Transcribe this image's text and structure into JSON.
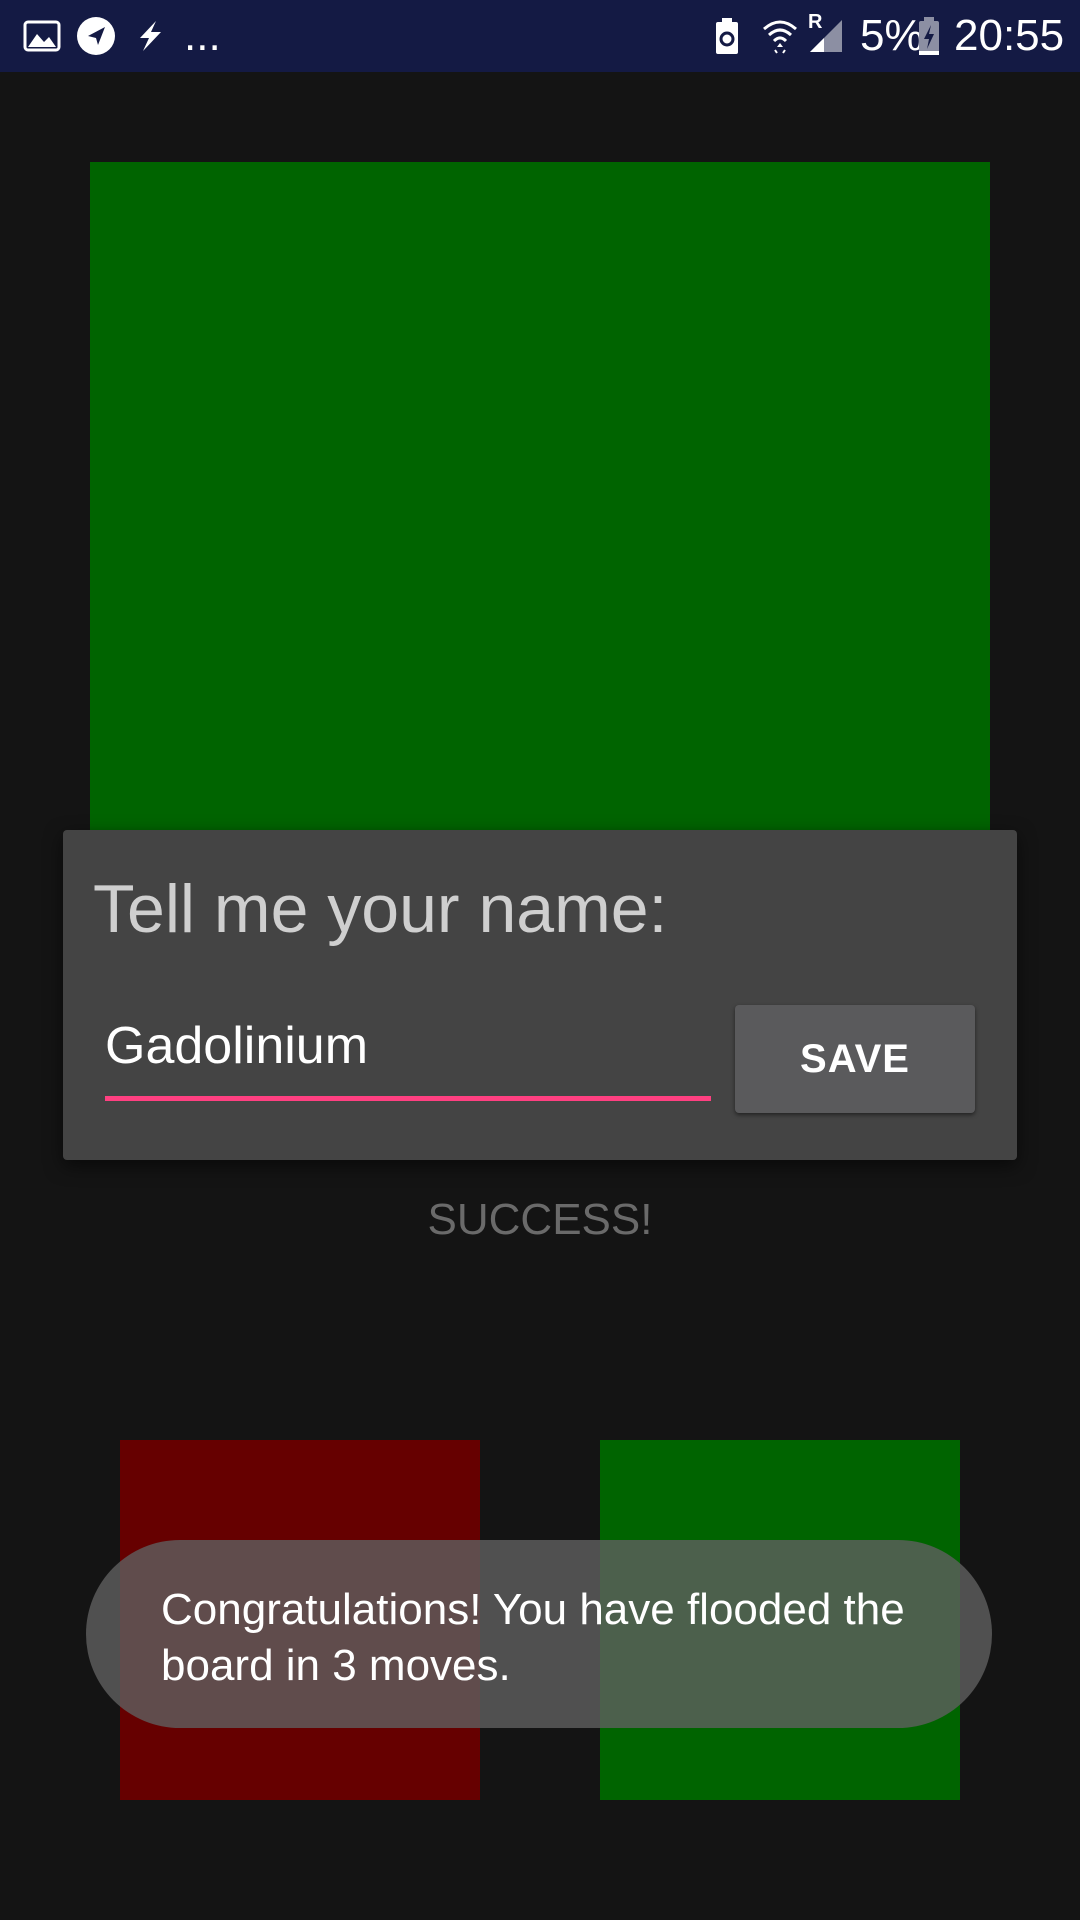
{
  "status_bar": {
    "icons_left": [
      "image-icon",
      "send-icon",
      "flash-icon"
    ],
    "overflow": "...",
    "icons_right": [
      "battery-saver-icon",
      "wifi-icon",
      "signal-icon"
    ],
    "roaming": "R",
    "battery_percent": "5%",
    "time": "20:55"
  },
  "board": {
    "color": "#006400"
  },
  "dialog": {
    "title": "Tell me your name:",
    "name_value": "Gadolinium",
    "save_label": "SAVE",
    "accent_color": "#ff4081"
  },
  "result": {
    "status": "SUCCESS!"
  },
  "color_buttons": [
    {
      "color": "#660000",
      "icon": "red-color-button"
    },
    {
      "color": "#006400",
      "icon": "green-color-button"
    }
  ],
  "toast": {
    "message": "Congratulations! You have flooded the board in 3 moves."
  }
}
